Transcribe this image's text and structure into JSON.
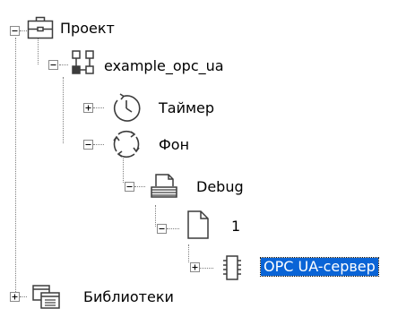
{
  "tree": {
    "nodes": [
      {
        "label": "Проект",
        "icon": "briefcase-icon",
        "expanded": true
      },
      {
        "label": "example_opc_ua",
        "icon": "network-nodes-icon",
        "expanded": true
      },
      {
        "label": "Таймер",
        "icon": "clock-icon",
        "expanded": false
      },
      {
        "label": "Фон",
        "icon": "cycle-arrows-icon",
        "expanded": true
      },
      {
        "label": "Debug",
        "icon": "document-stack-icon",
        "expanded": true
      },
      {
        "label": "1",
        "icon": "document-icon",
        "expanded": true
      },
      {
        "label": "OPC UA-сервер",
        "icon": "chip-icon",
        "expanded": false,
        "selected": true
      },
      {
        "label": "Библиотеки",
        "icon": "library-windows-icon",
        "expanded": false
      }
    ],
    "colors": {
      "selection": "#0a64d6",
      "selection_text": "#ffffff",
      "lines": "#7f7f7f",
      "icon_stroke": "#3c3c3c"
    }
  }
}
